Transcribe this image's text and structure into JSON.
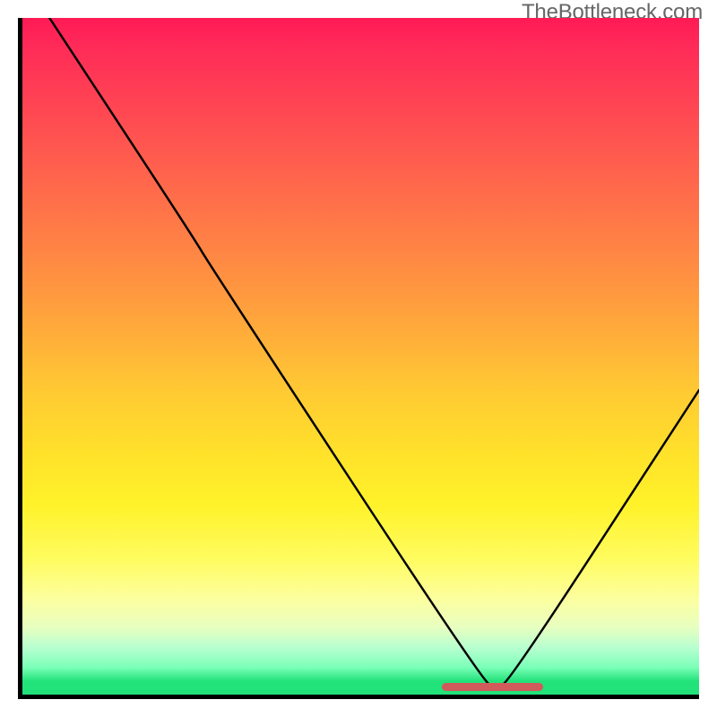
{
  "watermark": "TheBottleneck.com",
  "chart_data": {
    "type": "line",
    "title": "",
    "xlabel": "",
    "ylabel": "",
    "xlim": [
      0,
      100
    ],
    "ylim": [
      0,
      100
    ],
    "series": [
      {
        "name": "bottleneck-curve",
        "points": [
          {
            "x": 4,
            "y": 100
          },
          {
            "x": 25,
            "y": 68
          },
          {
            "x": 28,
            "y": 63
          },
          {
            "x": 68,
            "y": 2
          },
          {
            "x": 70,
            "y": 1
          },
          {
            "x": 72,
            "y": 2
          },
          {
            "x": 100,
            "y": 45
          }
        ]
      }
    ],
    "marker": {
      "x_start": 62,
      "x_end": 77,
      "y": 1.2,
      "color": "#d15a5a"
    },
    "gradient_stops": [
      {
        "pos": 0,
        "color": "#ff1a55"
      },
      {
        "pos": 40,
        "color": "#ff9640"
      },
      {
        "pos": 72,
        "color": "#fff22a"
      },
      {
        "pos": 100,
        "color": "#22e27a"
      }
    ]
  }
}
